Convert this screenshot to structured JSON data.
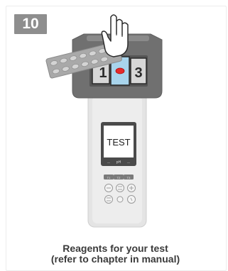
{
  "step": {
    "number": "10"
  },
  "device": {
    "screen_text": "TEST",
    "screen_bar_center": "pH",
    "screen_bar_left": "—",
    "screen_bar_right": "—",
    "chamber_left_label": "1",
    "chamber_right_label": "3",
    "keys_top": [
      "T1",
      "T2",
      "T3"
    ]
  },
  "caption": {
    "line1": "Reagents for your test",
    "line2": "(refer to chapter in manual)"
  }
}
